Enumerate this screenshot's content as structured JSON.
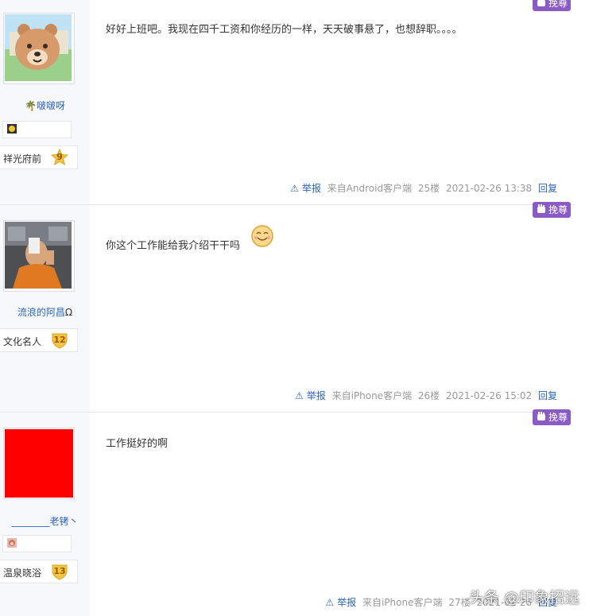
{
  "posts": [
    {
      "username": "啵啵呀",
      "level_name": "祥光府前",
      "level_num": "9",
      "content": "好好上班吧。我现在四千工资和你经历的一样，天天破事悬了，也想辞职。。。。",
      "report": "举报",
      "client": "来自Android客户端",
      "floor": "25楼",
      "time": "2021-02-26 13:38",
      "reply": "回复",
      "zan": "挽尊"
    },
    {
      "username": "流浪的阿昌",
      "level_name": "文化名人",
      "level_num": "12",
      "content": "你这个工作能给我介绍干干吗",
      "report": "举报",
      "client": "来自iPhone客户端",
      "floor": "26楼",
      "time": "2021-02-26 15:02",
      "reply": "回复",
      "zan": "挽尊"
    },
    {
      "username": "________老铐丶",
      "level_name": "温泉晓浴",
      "level_num": "13",
      "content": "工作挺好的啊",
      "report": "举报",
      "client": "来自iPhone客户端",
      "floor": "27楼",
      "time": "2021-02-26 ",
      "reply": "回复",
      "zan": "挽尊"
    }
  ],
  "watermark": "头条 @印象招远",
  "colors": {
    "link": "#2d64b3",
    "zan": "#8a5bc4",
    "level_star": "#f4c542"
  }
}
